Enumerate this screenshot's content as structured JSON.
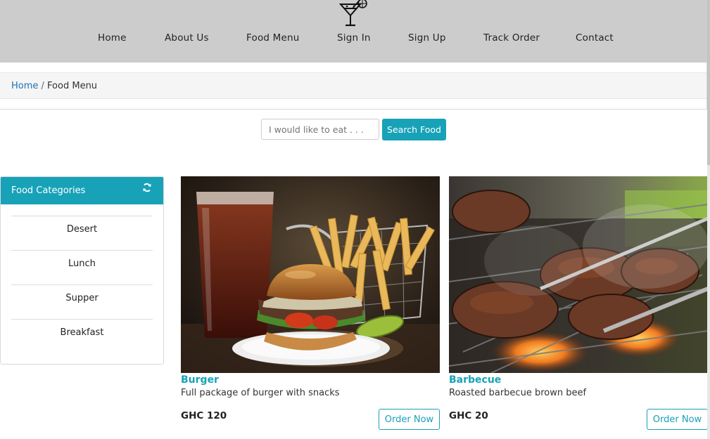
{
  "nav": {
    "items": [
      "Home",
      "About Us",
      "Food Menu",
      "Sign In",
      "Sign Up",
      "Track Order",
      "Contact"
    ]
  },
  "breadcrumb": {
    "home": "Home",
    "separator": " / ",
    "current": "Food Menu"
  },
  "search": {
    "placeholder": "I would like to eat . . .",
    "button_label": "Search Food"
  },
  "sidebar": {
    "title": "Food Categories",
    "categories": [
      "Desert",
      "Lunch",
      "Supper",
      "Breakfast"
    ]
  },
  "foods": [
    {
      "title": "Burger",
      "description": "Full package of burger with snacks",
      "price": "GHC 120",
      "button_label": "Order Now"
    },
    {
      "title": "Barbecue",
      "description": "Roasted barbecue brown beef",
      "price": "GHC 20",
      "button_label": "Order Now"
    }
  ],
  "colors": {
    "accent": "#17a2b8",
    "header_bg": "#cccccc",
    "link": "#1a73b8"
  },
  "icons": [
    "cocktail-logo-icon",
    "refresh-icon"
  ]
}
